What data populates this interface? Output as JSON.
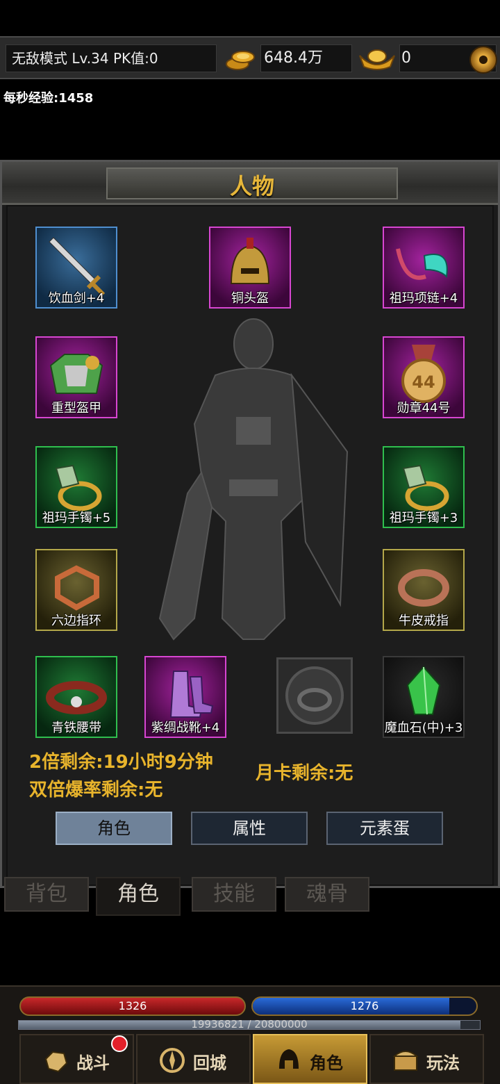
{
  "topbar": {
    "mode_text": "无敌模式  Lv.34 PK值:0",
    "gold": "648.4万",
    "ingot": "0"
  },
  "exp_per_sec": "每秒经验:1458",
  "panel": {
    "title": "人物",
    "slots": [
      {
        "label": "饮血剑+4",
        "quality": "blue"
      },
      {
        "label": "铜头盔",
        "quality": "purple"
      },
      {
        "label": "祖玛项链+4",
        "quality": "purple"
      },
      {
        "label": "重型盔甲",
        "quality": "purple"
      },
      {
        "label": "勋章44号",
        "quality": "purple"
      },
      {
        "label": "祖玛手镯+5",
        "quality": "green"
      },
      {
        "label": "祖玛手镯+3",
        "quality": "green"
      },
      {
        "label": "六边指环",
        "quality": "yellow"
      },
      {
        "label": "牛皮戒指",
        "quality": "yellow"
      },
      {
        "label": "青铁腰带",
        "quality": "green"
      },
      {
        "label": "紫绸战靴+4",
        "quality": "purple"
      },
      {
        "label": "魔血石(中)+3",
        "quality": "dark"
      }
    ],
    "bonus": {
      "double_exp": "2倍剩余:19小时9分钟",
      "double_drop": "双倍爆率剩余:无",
      "month_card": "月卡剩余:无"
    },
    "sub_tabs": [
      "角色",
      "属性",
      "元素蛋"
    ]
  },
  "bag_tabs": [
    "背包",
    "角色",
    "技能",
    "魂骨"
  ],
  "stats": {
    "hp": "1326",
    "mp": "1276",
    "mp_fill_ratio": 0.88,
    "exp": "19936821 / 20800000",
    "exp_fill_ratio": 0.958
  },
  "nav": [
    "战斗",
    "回城",
    "角色",
    "玩法"
  ],
  "colors": {
    "accent": "#e8b42c",
    "hp": "#c8282a",
    "mp": "#2a6ad8"
  }
}
